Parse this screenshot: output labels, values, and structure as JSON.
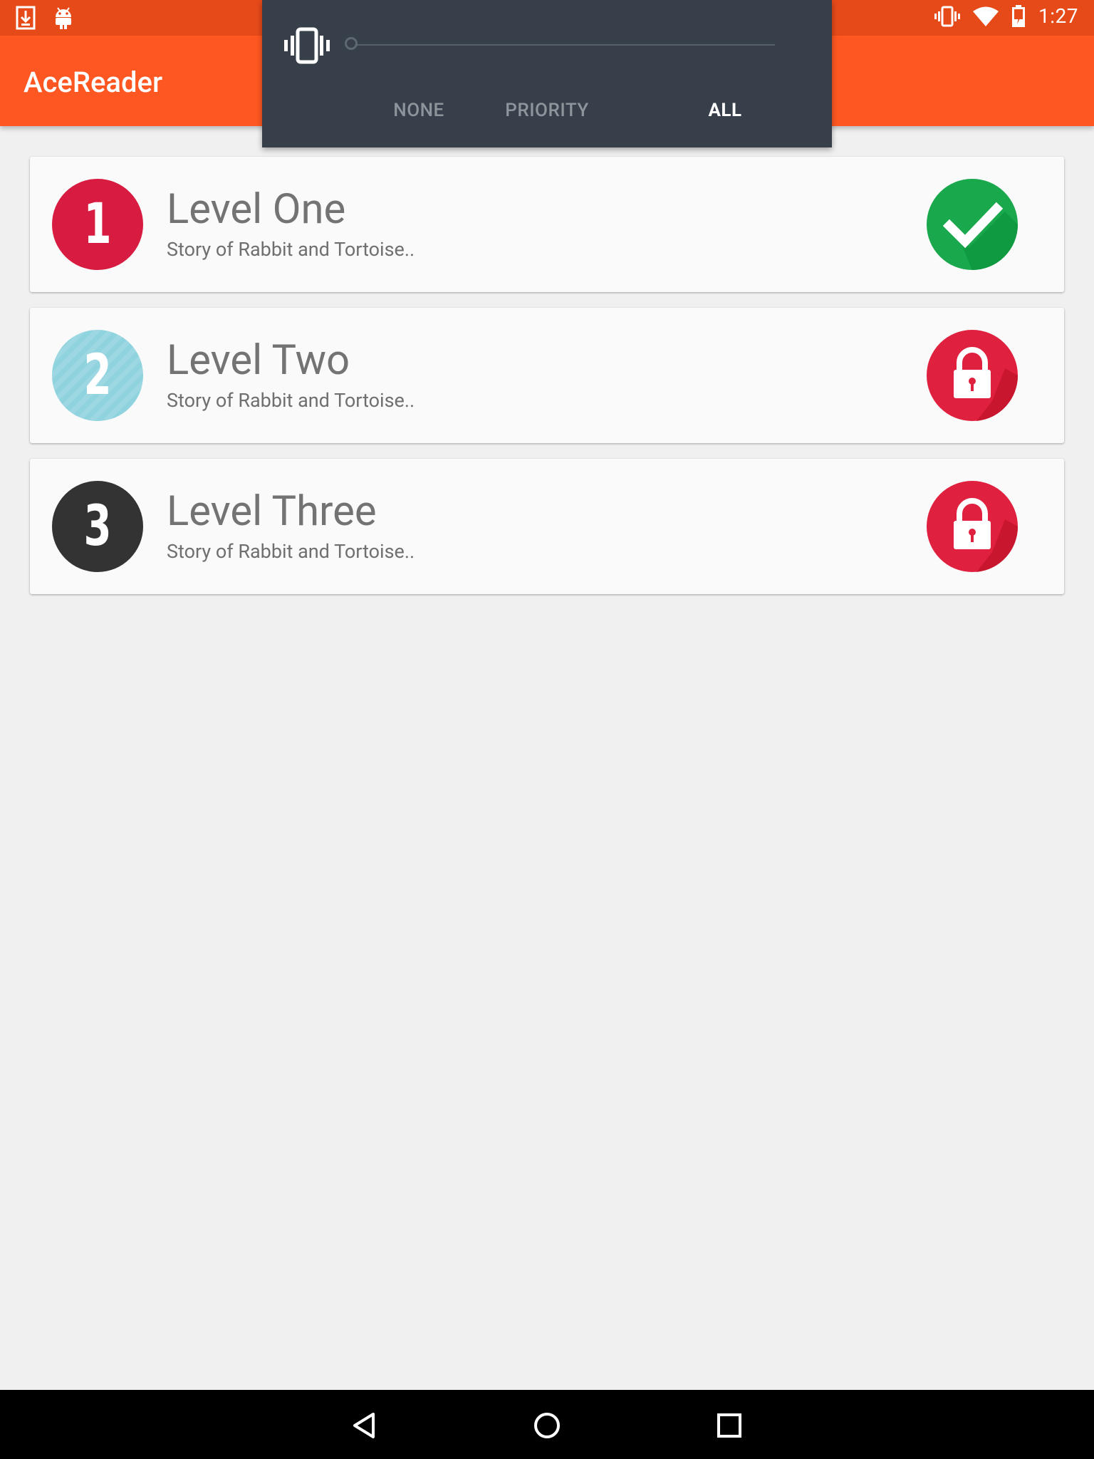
{
  "status_bar": {
    "time": "1:27",
    "left_icons": [
      "download-icon",
      "android-icon"
    ],
    "right_icons": [
      "vibrate-icon",
      "wifi-icon",
      "battery-charging-icon"
    ]
  },
  "app_bar": {
    "title": "AceReader"
  },
  "volume_panel": {
    "icon": "vibrate-icon",
    "level_fraction": 0,
    "tabs": [
      {
        "label": "NONE",
        "active": false
      },
      {
        "label": "PRIORITY",
        "active": false
      },
      {
        "label": "ALL",
        "active": true
      }
    ]
  },
  "levels": [
    {
      "number": "1",
      "title": "Level One",
      "subtitle": "Story of Rabbit and Tortoise..",
      "badge_color": "#d81b40",
      "status": "completed",
      "status_icon": "checkmark-icon",
      "status_color": "#16a34a"
    },
    {
      "number": "2",
      "title": "Level Two",
      "subtitle": "Story of Rabbit and Tortoise..",
      "badge_color": "#8fd3de",
      "status": "locked",
      "status_icon": "lock-icon",
      "status_color": "#e0203f"
    },
    {
      "number": "3",
      "title": "Level Three",
      "subtitle": "Story of Rabbit and Tortoise..",
      "badge_color": "#333333",
      "status": "locked",
      "status_icon": "lock-icon",
      "status_color": "#e0203f"
    }
  ],
  "nav_bar": {
    "buttons": [
      "back-icon",
      "home-icon",
      "recents-icon"
    ]
  },
  "colors": {
    "status_bar": "#e64a19",
    "app_bar": "#ff5722",
    "background": "#f0f0f0",
    "volume_panel": "#37404a"
  }
}
